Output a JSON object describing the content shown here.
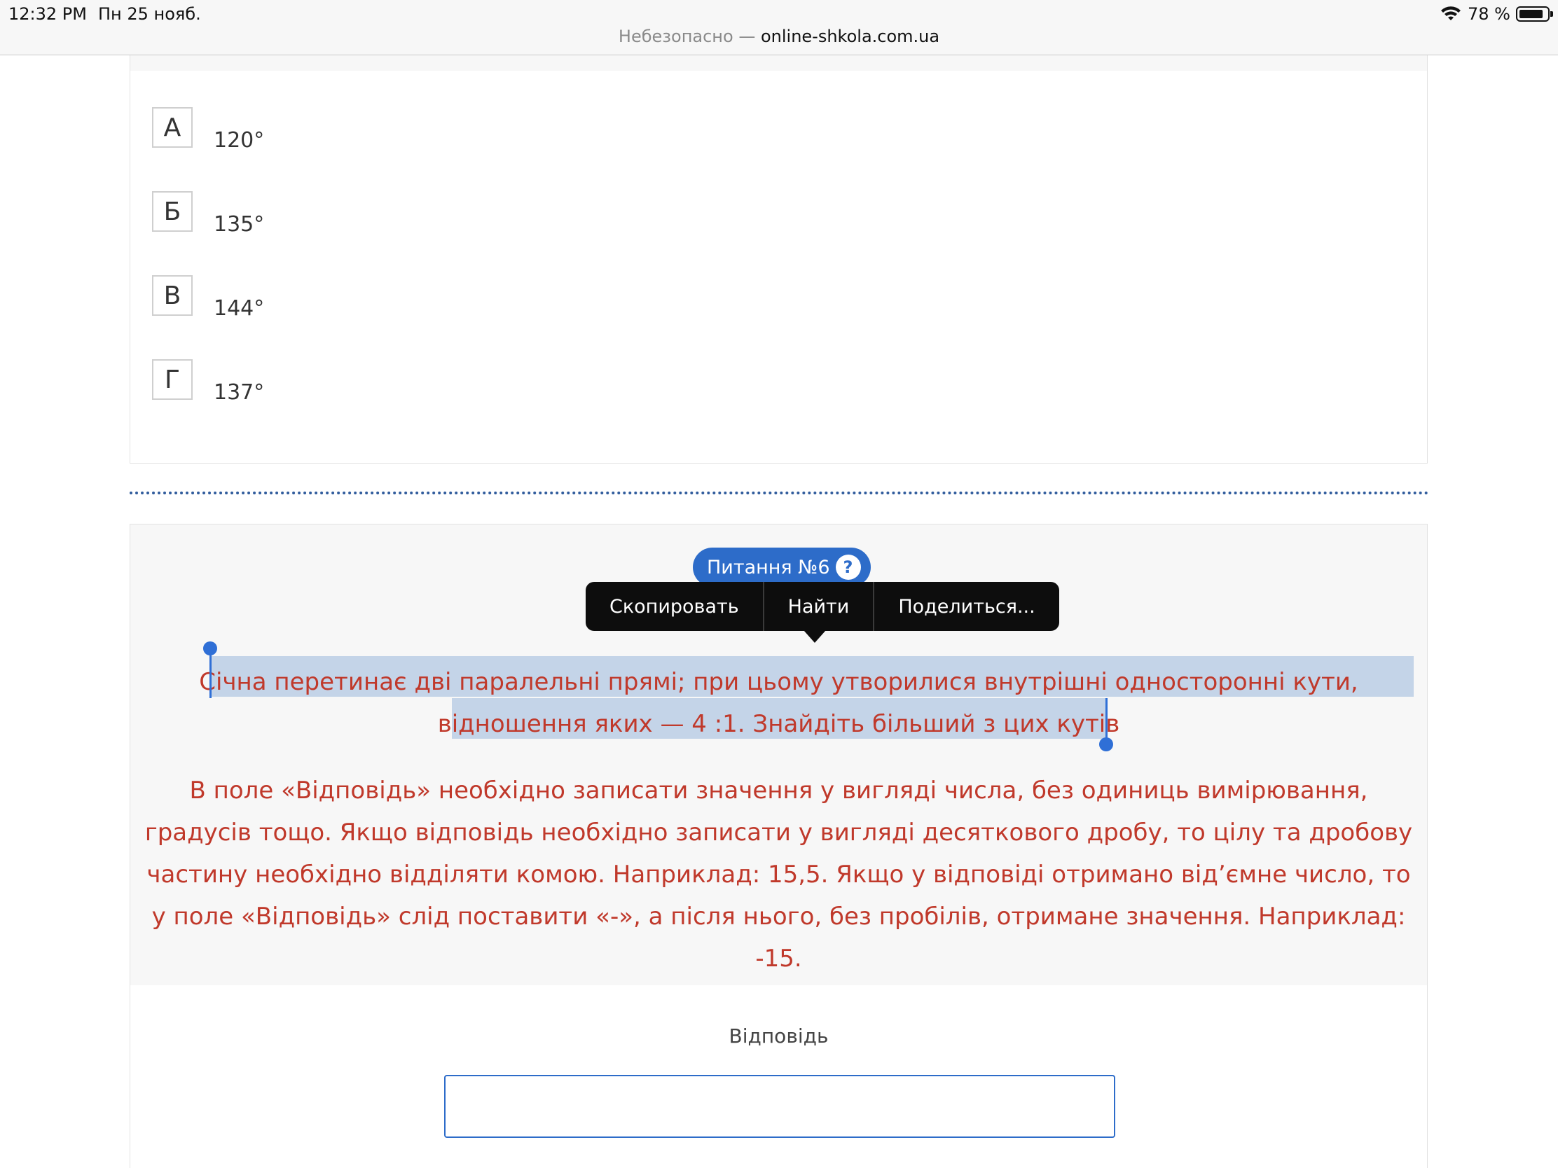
{
  "status_bar": {
    "time": "12:32 PM",
    "date": "Пн 25 нояб.",
    "battery": "78 %"
  },
  "address_bar": {
    "security": "Небезопасно",
    "separator": "—",
    "domain": "online-shkola.com.ua"
  },
  "prev_question": {
    "options": [
      {
        "letter": "А",
        "value": "120°"
      },
      {
        "letter": "Б",
        "value": "135°"
      },
      {
        "letter": "В",
        "value": "144°"
      },
      {
        "letter": "Г",
        "value": "137°"
      }
    ]
  },
  "question": {
    "badge": "Питання №6",
    "help": "?",
    "text_line1": "Січна перетинає дві паралельні прямі; при цьому утворилися внутрішні односторонні кути,",
    "text_line2": "відношення яких — 4 :1. Знайдіть більший з цих кутів",
    "instructions": "В поле «Відповідь» необхідно записати значення у вигляді числа, без одиниць вимірювання, градусів тощо. Якщо відповідь необхідно записати у вигляді десяткового дробу, то цілу та дробову частину необхідно відділяти комою. Наприклад: 15,5. Якщо у відповіді отримано від’ємне число, то у поле «Відповідь» слід поставити «-», а після нього, без пробілів, отримане значення. Наприклад: -15.",
    "answer_label": "Відповідь",
    "answer_value": ""
  },
  "context_menu": {
    "copy": "Скопировать",
    "find": "Найти",
    "share": "Поделиться..."
  },
  "colors": {
    "accent": "#2d6cc9",
    "question_text": "#c0392b",
    "selection": "#c4d4e8"
  }
}
